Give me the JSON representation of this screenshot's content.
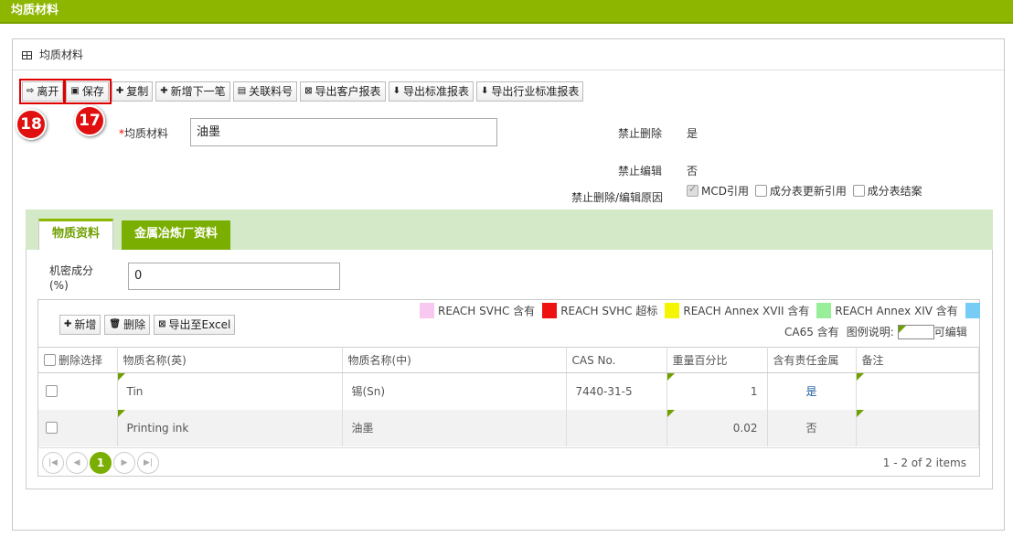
{
  "topbar": {
    "title": "均质材料"
  },
  "panel": {
    "title": "均质材料"
  },
  "toolbar": {
    "leave": "离开",
    "save": "保存",
    "copy": "复制",
    "add_next": "新增下一笔",
    "link_part": "关联料号",
    "export_customer": "导出客户报表",
    "export_standard": "导出标准报表",
    "export_industry": "导出行业标准报表"
  },
  "badges": {
    "leave": "18",
    "save": "17"
  },
  "form": {
    "material_label": "均质材料",
    "material_value": "油墨",
    "forbid_delete_label": "禁止删除",
    "forbid_delete_value": "是",
    "forbid_edit_label": "禁止编辑",
    "forbid_edit_value": "否",
    "reason_label": "禁止删除/编辑原因",
    "reasons": [
      "MCD引用",
      "成分表更新引用",
      "成分表结案"
    ]
  },
  "tabs": [
    "物质资料",
    "金属冶炼厂资料"
  ],
  "confidential": {
    "label_1": "机密成分",
    "label_2": "(%)",
    "value": "0"
  },
  "grid_toolbar": {
    "add": "新增",
    "delete": "删除",
    "export": "导出至Excel"
  },
  "legend": {
    "items": [
      {
        "label": "REACH SVHC 含有",
        "color": "#f9c8f0"
      },
      {
        "label": "REACH SVHC 超标",
        "color": "#ee1111"
      },
      {
        "label": "REACH Annex XVII 含有",
        "color": "#f5f500"
      },
      {
        "label": "REACH Annex XIV 含有",
        "color": "#99ee99"
      }
    ],
    "ca65_color": "#77ccf5",
    "ca65": "CA65 含有",
    "desc": "图例说明:",
    "editable": "可编辑"
  },
  "table": {
    "headers": [
      "删除选择",
      "物质名称(英)",
      "物质名称(中)",
      "CAS No.",
      "重量百分比",
      "含有责任金属",
      "备注"
    ],
    "rows": [
      {
        "en": "Tin",
        "cn": "锡(Sn)",
        "cas": "7440-31-5",
        "weight": "1",
        "metal": "是"
      },
      {
        "en": "Printing ink",
        "cn": "油墨",
        "cas": "",
        "weight": "0.02",
        "metal": "否"
      }
    ]
  },
  "pager": {
    "current": "1",
    "summary": "1 - 2 of 2 items"
  }
}
